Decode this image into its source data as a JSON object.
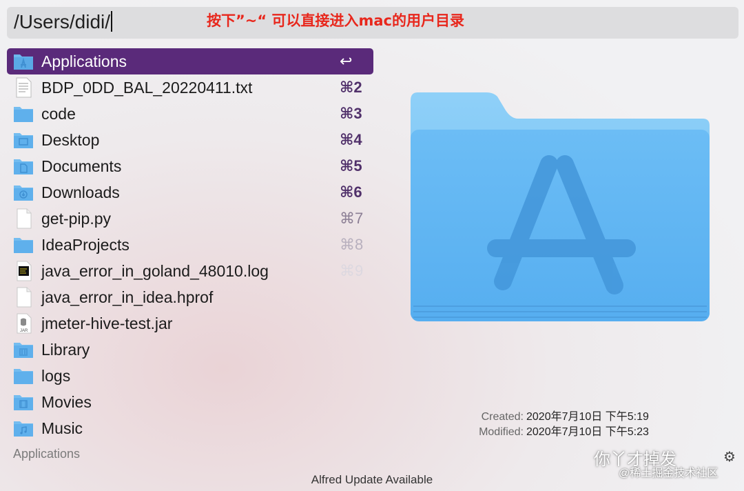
{
  "search": {
    "query": "/Users/didi/"
  },
  "annotation": {
    "text": "按下”~“ 可以直接进入mac的用户目录"
  },
  "results": [
    {
      "label": "Applications",
      "shortcut": "↩",
      "icon": "applications-folder-icon",
      "selected": true
    },
    {
      "label": "BDP_0DD_BAL_20220411.txt",
      "shortcut": "⌘2",
      "icon": "text-file-icon"
    },
    {
      "label": "code",
      "shortcut": "⌘3",
      "icon": "folder-icon"
    },
    {
      "label": "Desktop",
      "shortcut": "⌘4",
      "icon": "desktop-folder-icon"
    },
    {
      "label": "Documents",
      "shortcut": "⌘5",
      "icon": "documents-folder-icon"
    },
    {
      "label": "Downloads",
      "shortcut": "⌘6",
      "icon": "downloads-folder-icon"
    },
    {
      "label": "get-pip.py",
      "shortcut": "⌘7",
      "icon": "document-icon"
    },
    {
      "label": "IdeaProjects",
      "shortcut": "⌘8",
      "icon": "folder-icon"
    },
    {
      "label": "java_error_in_goland_48010.log",
      "shortcut": "⌘9",
      "icon": "log-file-icon"
    },
    {
      "label": "java_error_in_idea.hprof",
      "shortcut": "",
      "icon": "document-icon"
    },
    {
      "label": "jmeter-hive-test.jar",
      "shortcut": "",
      "icon": "jar-file-icon"
    },
    {
      "label": "Library",
      "shortcut": "",
      "icon": "library-folder-icon"
    },
    {
      "label": "logs",
      "shortcut": "",
      "icon": "folder-icon"
    },
    {
      "label": "Movies",
      "shortcut": "",
      "icon": "movies-folder-icon"
    },
    {
      "label": "Music",
      "shortcut": "",
      "icon": "music-folder-icon"
    }
  ],
  "footer": {
    "section_label": "Applications",
    "update_status": "Alfred Update Available"
  },
  "preview": {
    "icon": "applications-folder-large-icon",
    "created_label": "Created:",
    "created_value": "2020年7月10日 下午5:19",
    "modified_label": "Modified:",
    "modified_value": "2020年7月10日 下午5:23"
  },
  "watermark": {
    "line1": "你丫才掉发",
    "line2": "@稀土掘金技术社区"
  },
  "colors": {
    "selected_bg": "#5a2a7a",
    "annotation": "#e8271c",
    "folder_blue": "#5fb3f0"
  }
}
